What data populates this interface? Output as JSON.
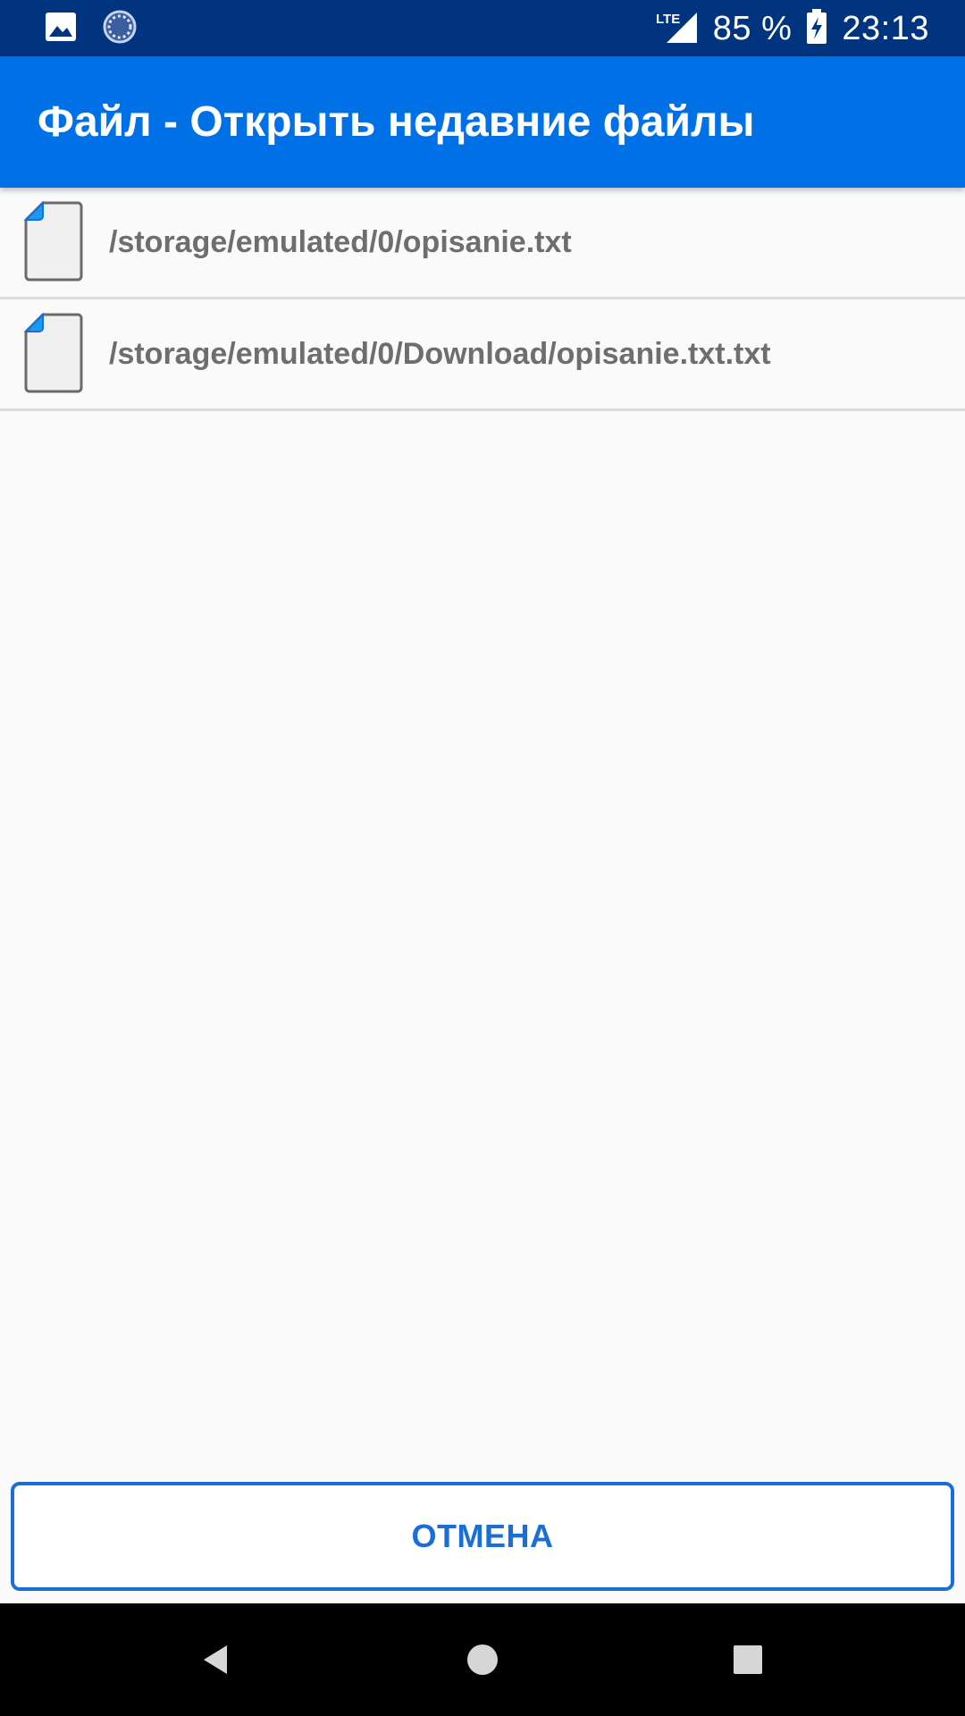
{
  "status_bar": {
    "network_label": "LTE",
    "battery_percent": "85 %",
    "time": "23:13",
    "icons": [
      "image-icon",
      "loading-icon",
      "signal-icon",
      "battery-charging-icon"
    ]
  },
  "app_bar": {
    "title": "Файл - Открыть недавние файлы"
  },
  "files": [
    {
      "path": "/storage/emulated/0/opisanie.txt",
      "icon": "file-icon"
    },
    {
      "path": "/storage/emulated/0/Download/opisanie.txt.txt",
      "icon": "file-icon"
    }
  ],
  "cancel_button": {
    "label": "ОТМЕНА"
  },
  "nav_bar": {
    "icons": [
      "back-icon",
      "home-icon",
      "recents-icon"
    ]
  },
  "colors": {
    "status_bar": "#01347f",
    "app_bar": "#0070e6",
    "accent": "#1a6fd6",
    "file_corner": "#1a9af0"
  }
}
